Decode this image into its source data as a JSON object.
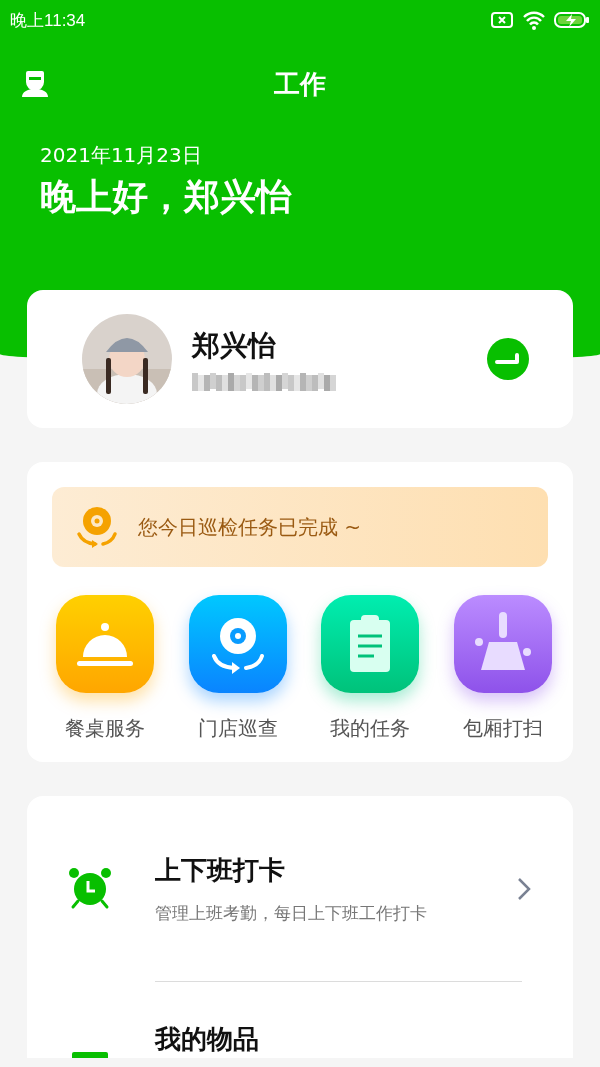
{
  "status_bar": {
    "time": "晚上11:34"
  },
  "header": {
    "title": "工作",
    "date": "2021年11月23日",
    "greeting": "晚上好，郑兴怡"
  },
  "profile": {
    "name": "郑兴怡"
  },
  "notice": {
    "text": "您今日巡检任务已完成 ~"
  },
  "shortcuts": [
    {
      "label": "餐桌服务",
      "kind": "cloche"
    },
    {
      "label": "门店巡查",
      "kind": "patrol"
    },
    {
      "label": "我的任务",
      "kind": "clipboard"
    },
    {
      "label": "包厢打扫",
      "kind": "broom"
    }
  ],
  "menu": [
    {
      "kind": "alarm",
      "title": "上下班打卡",
      "subtitle": "管理上班考勤，每日上下班工作打卡"
    },
    {
      "kind": "items",
      "title": "我的物品"
    }
  ]
}
